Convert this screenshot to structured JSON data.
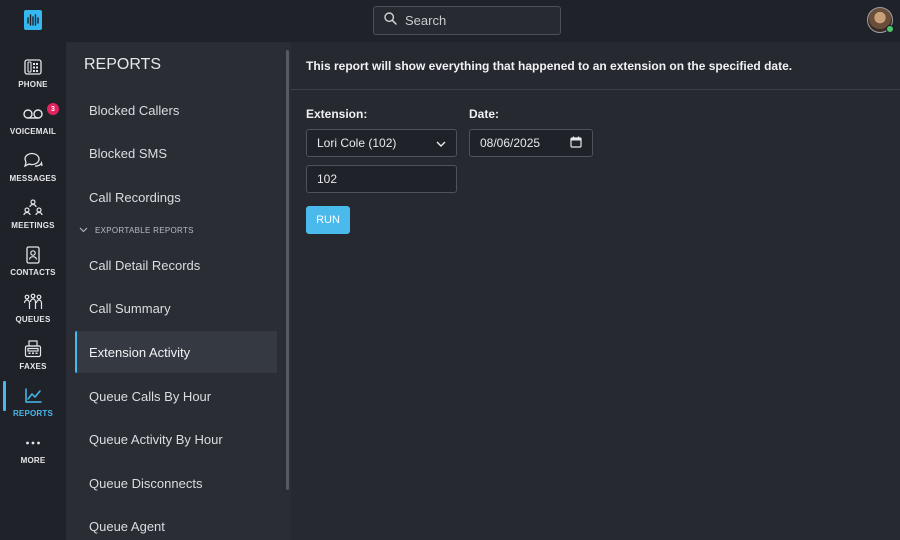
{
  "search": {
    "placeholder": "Search"
  },
  "rail": {
    "items": [
      {
        "label": "PHONE",
        "icon": "phone-icon"
      },
      {
        "label": "VOICEMAIL",
        "icon": "voicemail-icon",
        "badge": "3"
      },
      {
        "label": "MESSAGES",
        "icon": "messages-icon"
      },
      {
        "label": "MEETINGS",
        "icon": "meetings-icon"
      },
      {
        "label": "CONTACTS",
        "icon": "contacts-icon"
      },
      {
        "label": "QUEUES",
        "icon": "queues-icon"
      },
      {
        "label": "FAXES",
        "icon": "fax-icon"
      },
      {
        "label": "REPORTS",
        "icon": "reports-icon",
        "active": true
      },
      {
        "label": "MORE",
        "icon": "more-icon"
      }
    ]
  },
  "reports": {
    "title": "REPORTS",
    "items": [
      "Blocked Callers",
      "Blocked SMS",
      "Call Recordings"
    ],
    "section_label": "EXPORTABLE REPORTS",
    "exportable": [
      "Call Detail Records",
      "Call Summary",
      "Extension Activity",
      "Queue Calls By Hour",
      "Queue Activity By Hour",
      "Queue Disconnects",
      "Queue Agent"
    ],
    "active": "Extension Activity"
  },
  "main": {
    "description": "This report will show everything that happened to an extension on the specified date.",
    "extension_label": "Extension:",
    "extension_selected": "Lori Cole (102)",
    "extension_value": "102",
    "date_label": "Date:",
    "date_value": "08/06/2025",
    "run_label": "RUN"
  },
  "colors": {
    "accent": "#48b9ee",
    "badge": "#e0245e",
    "online": "#4cc76a"
  }
}
